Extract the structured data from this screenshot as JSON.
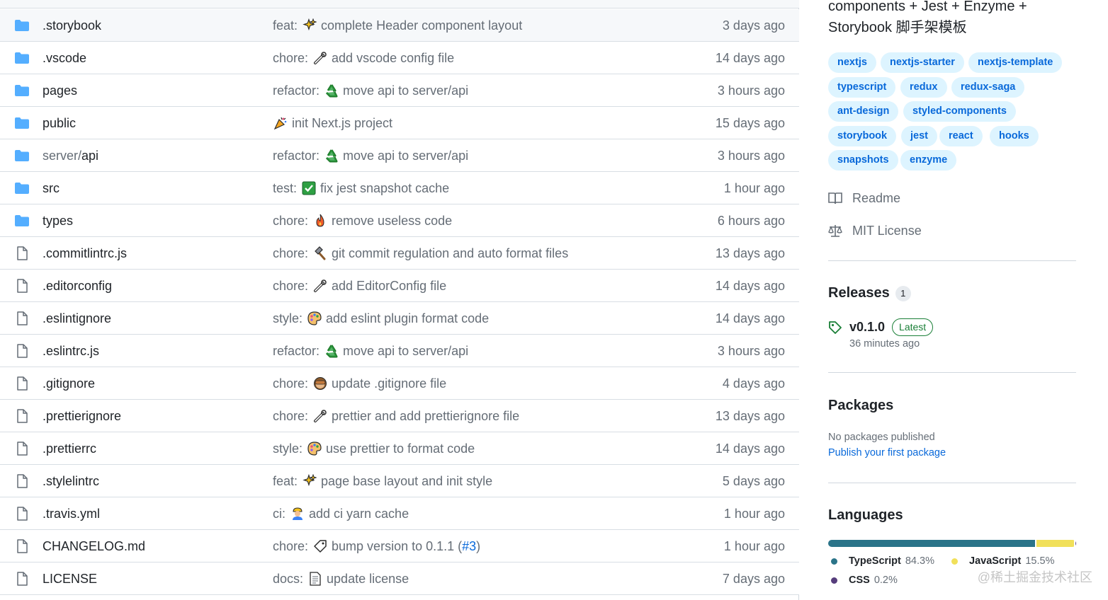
{
  "files": [
    {
      "type": "dir",
      "name": ".storybook",
      "prefix": "",
      "commit_type": "feat:",
      "emoji": "sparkles-icon",
      "message": "complete Header component layout",
      "pr": "",
      "age": "3 days ago"
    },
    {
      "type": "dir",
      "name": ".vscode",
      "prefix": "",
      "commit_type": "chore:",
      "emoji": "wrench-icon",
      "message": "add vscode config file",
      "pr": "",
      "age": "14 days ago"
    },
    {
      "type": "dir",
      "name": "pages",
      "prefix": "",
      "commit_type": "refactor:",
      "emoji": "recycle-icon",
      "message": "move api to server/api",
      "pr": "",
      "age": "3 hours ago"
    },
    {
      "type": "dir",
      "name": "public",
      "prefix": "",
      "commit_type": "",
      "emoji": "party-popper-icon",
      "message": "init Next.js project",
      "pr": "",
      "age": "15 days ago"
    },
    {
      "type": "dir",
      "name": "api",
      "prefix": "server/",
      "commit_type": "refactor:",
      "emoji": "recycle-icon",
      "message": "move api to server/api",
      "pr": "",
      "age": "3 hours ago"
    },
    {
      "type": "dir",
      "name": "src",
      "prefix": "",
      "commit_type": "test:",
      "emoji": "check-mark-icon",
      "message": "fix jest snapshot cache",
      "pr": "",
      "age": "1 hour ago"
    },
    {
      "type": "dir",
      "name": "types",
      "prefix": "",
      "commit_type": "chore:",
      "emoji": "fire-icon",
      "message": "remove useless code",
      "pr": "",
      "age": "6 hours ago"
    },
    {
      "type": "file",
      "name": ".commitlintrc.js",
      "prefix": "",
      "commit_type": "chore:",
      "emoji": "hammer-icon",
      "message": "git commit regulation and auto format files",
      "pr": "",
      "age": "13 days ago"
    },
    {
      "type": "file",
      "name": ".editorconfig",
      "prefix": "",
      "commit_type": "chore:",
      "emoji": "wrench-icon",
      "message": "add EditorConfig file",
      "pr": "",
      "age": "14 days ago"
    },
    {
      "type": "file",
      "name": ".eslintignore",
      "prefix": "",
      "commit_type": "style:",
      "emoji": "palette-icon",
      "message": "add eslint plugin format code",
      "pr": "",
      "age": "14 days ago"
    },
    {
      "type": "file",
      "name": ".eslintrc.js",
      "prefix": "",
      "commit_type": "refactor:",
      "emoji": "recycle-icon",
      "message": "move api to server/api",
      "pr": "",
      "age": "3 hours ago"
    },
    {
      "type": "file",
      "name": ".gitignore",
      "prefix": "",
      "commit_type": "chore:",
      "emoji": "see-no-evil-monkey-icon",
      "message": "update .gitignore file",
      "pr": "",
      "age": "4 days ago"
    },
    {
      "type": "file",
      "name": ".prettierignore",
      "prefix": "",
      "commit_type": "chore:",
      "emoji": "wrench-icon",
      "message": "prettier and add prettierignore file",
      "pr": "",
      "age": "13 days ago"
    },
    {
      "type": "file",
      "name": ".prettierrc",
      "prefix": "",
      "commit_type": "style:",
      "emoji": "palette-icon",
      "message": "use prettier to format code",
      "pr": "",
      "age": "14 days ago"
    },
    {
      "type": "file",
      "name": ".stylelintrc",
      "prefix": "",
      "commit_type": "feat:",
      "emoji": "sparkles-icon",
      "message": "page base layout and init style",
      "pr": "",
      "age": "5 days ago"
    },
    {
      "type": "file",
      "name": ".travis.yml",
      "prefix": "",
      "commit_type": "ci:",
      "emoji": "construction-worker-icon",
      "message": "add ci yarn cache",
      "pr": "",
      "age": "1 hour ago"
    },
    {
      "type": "file",
      "name": "CHANGELOG.md",
      "prefix": "",
      "commit_type": "chore:",
      "emoji": "bookmark-icon",
      "message": "bump version to 0.1.1 (",
      "pr": "#3",
      "age": "1 hour ago"
    },
    {
      "type": "file",
      "name": "LICENSE",
      "prefix": "",
      "commit_type": "docs:",
      "emoji": "page-icon",
      "message": "update license",
      "pr": "",
      "age": "7 days ago"
    }
  ],
  "sidebar": {
    "about_line1": "components + Jest + Enzyme +",
    "about_line2": "Storybook 脚手架模板",
    "topics": [
      "nextjs",
      "nextjs-starter",
      "nextjs-template",
      "typescript",
      "redux",
      "redux-saga",
      "ant-design",
      "styled-components",
      "storybook",
      "jest",
      "react",
      "hooks",
      "snapshots",
      "enzyme"
    ],
    "readme_label": "Readme",
    "license_label": "MIT License",
    "releases": {
      "title": "Releases",
      "count": "1",
      "tag": "v0.1.0",
      "badge": "Latest",
      "date": "36 minutes ago"
    },
    "packages": {
      "title": "Packages",
      "none_text": "No packages published",
      "link_text": "Publish your first package"
    },
    "languages": {
      "title": "Languages",
      "items": [
        {
          "name": "TypeScript",
          "percent": "84.3%",
          "value": 84.3,
          "color": "#2b7489"
        },
        {
          "name": "JavaScript",
          "percent": "15.5%",
          "value": 15.5,
          "color": "#f1e05a"
        },
        {
          "name": "CSS",
          "percent": "0.2%",
          "value": 0.2,
          "color": "#563d7c"
        }
      ]
    },
    "watermark": "@稀土掘金技术社区"
  }
}
